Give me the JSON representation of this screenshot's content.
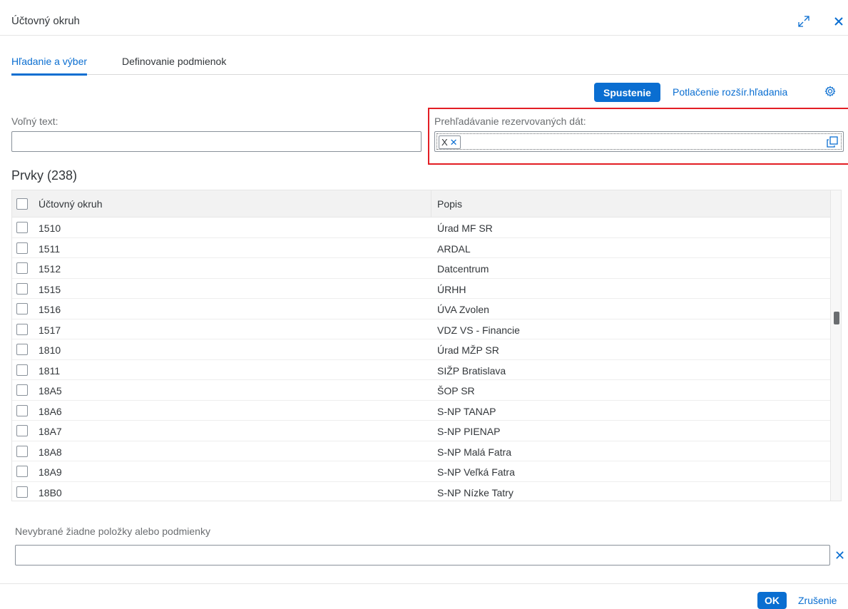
{
  "dialog": {
    "title": "Účtovný okruh",
    "expand_icon": "expand-diagonal-icon",
    "close_icon": "close-icon"
  },
  "tabs": [
    {
      "label": "Hľadanie a výber",
      "selected": true
    },
    {
      "label": "Definovanie podmienok",
      "selected": false
    }
  ],
  "toolbar": {
    "go_label": "Spustenie",
    "suppress_label": "Potlačenie rozšír.hľadania",
    "settings_icon": "gear-icon"
  },
  "filters": {
    "free_text_label": "Voľný text:",
    "free_text_value": "",
    "reserved_label": "Prehľadávanie rezervovaných dát:",
    "reserved_token": "X",
    "value_help_icon": "value-help-icon"
  },
  "items": {
    "title": "Prvky (238)",
    "columns": [
      "Účtovný okruh",
      "Popis"
    ],
    "rows": [
      {
        "code": "1510",
        "desc": "Úrad MF SR"
      },
      {
        "code": "1511",
        "desc": "ARDAL"
      },
      {
        "code": "1512",
        "desc": "Datcentrum"
      },
      {
        "code": "1515",
        "desc": "ÚRHH"
      },
      {
        "code": "1516",
        "desc": "ÚVA Zvolen"
      },
      {
        "code": "1517",
        "desc": "VDZ VS - Financie"
      },
      {
        "code": "1810",
        "desc": "Úrad MŽP SR"
      },
      {
        "code": "1811",
        "desc": "SIŽP Bratislava"
      },
      {
        "code": "18A5",
        "desc": "ŠOP SR"
      },
      {
        "code": "18A6",
        "desc": "S-NP TANAP"
      },
      {
        "code": "18A7",
        "desc": "S-NP PIENAP"
      },
      {
        "code": "18A8",
        "desc": "S-NP Malá Fatra"
      },
      {
        "code": "18A9",
        "desc": "S-NP Veľká Fatra"
      },
      {
        "code": "18B0",
        "desc": "S-NP Nízke Tatry"
      }
    ]
  },
  "selection": {
    "label": "Nevybrané žiadne položky alebo podmienky",
    "value": ""
  },
  "footer": {
    "ok_label": "OK",
    "cancel_label": "Zrušenie"
  },
  "colors": {
    "accent": "#0a6ed1",
    "highlight": "#e31e24"
  }
}
